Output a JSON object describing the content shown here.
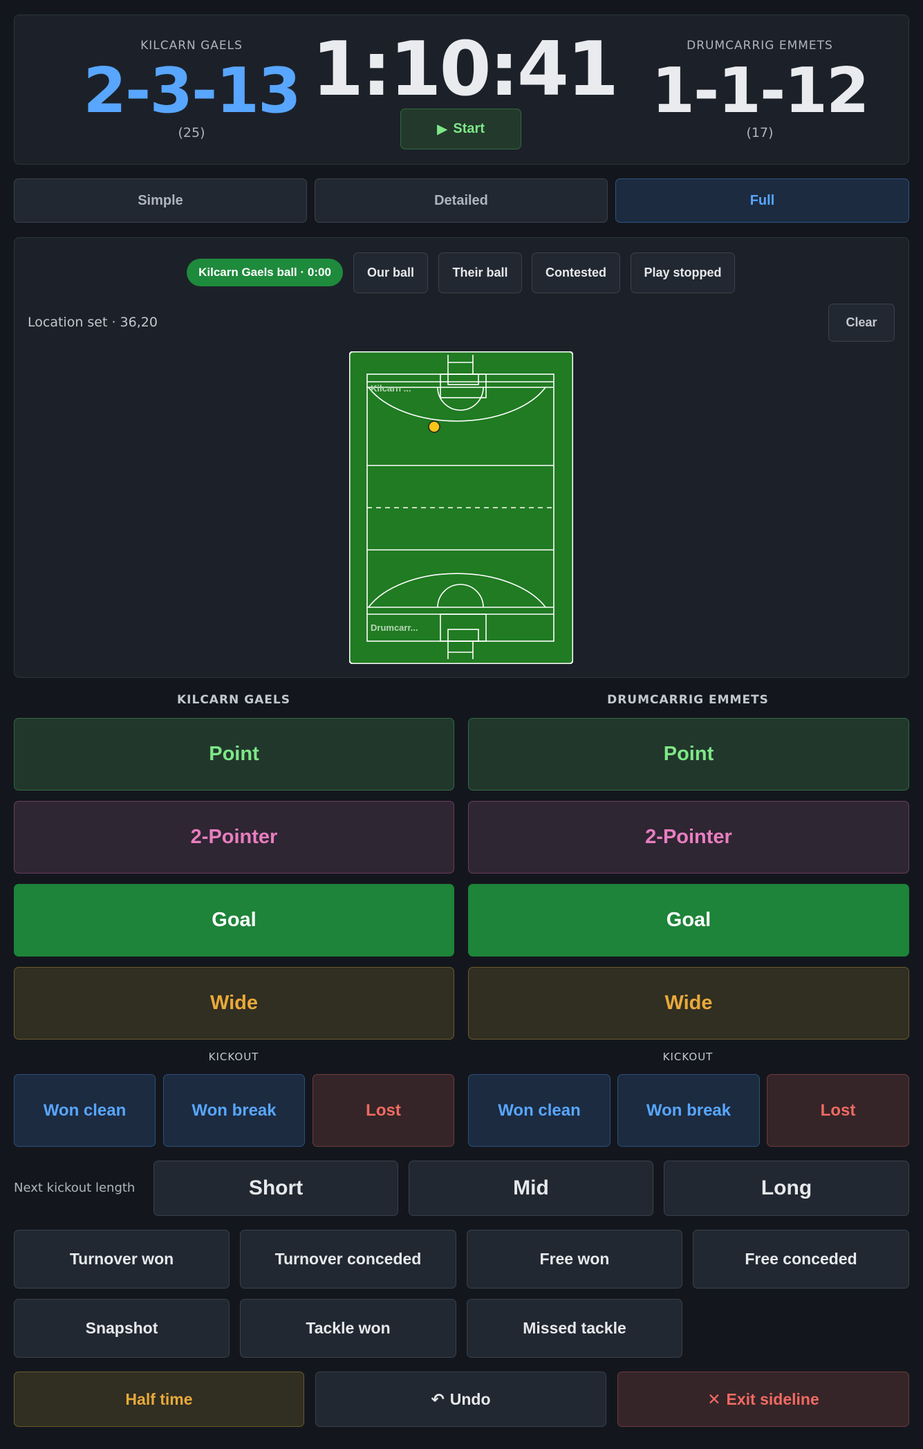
{
  "scoreboard": {
    "home": {
      "name": "KILCARN GAELS",
      "score": "2-3-13",
      "total": "(25)"
    },
    "away": {
      "name": "DRUMCARRIG EMMETS",
      "score": "1-1-12",
      "total": "(17)"
    },
    "clock": "1:10:41",
    "start_label": "Start"
  },
  "modes": {
    "simple": "Simple",
    "detailed": "Detailed",
    "full": "Full",
    "active": "Full"
  },
  "possession": {
    "status_pill": "Kilcarn Gaels ball · 0:00",
    "our_ball": "Our ball",
    "their_ball": "Their ball",
    "contested": "Contested",
    "play_stopped": "Play stopped"
  },
  "location": {
    "label": "Location set · 36,20",
    "clear_label": "Clear"
  },
  "pitch": {
    "top_team": "Kilcarn ...",
    "bottom_team": "Drumcarr...",
    "marker_color": "#f5c518",
    "grass_color": "#207b22"
  },
  "home_actions": {
    "heading": "KILCARN GAELS",
    "point": "Point",
    "two_pointer": "2-Pointer",
    "goal": "Goal",
    "wide": "Wide",
    "kickout_label": "KICKOUT",
    "won_clean": "Won clean",
    "won_break": "Won break",
    "lost": "Lost"
  },
  "away_actions": {
    "heading": "DRUMCARRIG EMMETS",
    "point": "Point",
    "two_pointer": "2-Pointer",
    "goal": "Goal",
    "wide": "Wide",
    "kickout_label": "KICKOUT",
    "won_clean": "Won clean",
    "won_break": "Won break",
    "lost": "Lost"
  },
  "kickout_length": {
    "label": "Next kickout length",
    "short": "Short",
    "mid": "Mid",
    "long": "Long"
  },
  "events": {
    "turnover_won": "Turnover won",
    "turnover_conceded": "Turnover conceded",
    "free_won": "Free won",
    "free_conceded": "Free conceded",
    "snapshot": "Snapshot",
    "tackle_won": "Tackle won",
    "missed_tackle": "Missed tackle"
  },
  "footer": {
    "half_time": "Half time",
    "undo": "Undo",
    "exit": "Exit sideline"
  },
  "colors": {
    "accent_blue": "#58a6ff",
    "point_green": "#7ee787",
    "two_pointer_pink": "#e87ec0",
    "goal_green": "#1d8439",
    "wide_amber": "#e8a93a",
    "danger_red": "#f06a62"
  }
}
